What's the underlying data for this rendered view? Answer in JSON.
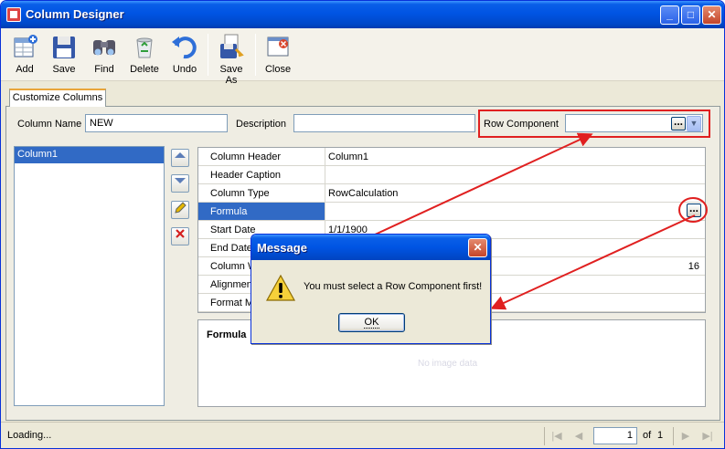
{
  "window": {
    "title": "Column Designer",
    "min_glyph": "_",
    "max_glyph": "□",
    "close_glyph": "✕"
  },
  "toolbar": {
    "add": "Add",
    "save": "Save",
    "find": "Find",
    "delete": "Delete",
    "undo": "Undo",
    "save_as": "Save As",
    "close": "Close"
  },
  "tabs": {
    "customize": "Customize Columns"
  },
  "form": {
    "column_name_label": "Column Name",
    "column_name_value": "NEW",
    "description_label": "Description",
    "description_value": "",
    "row_component_label": "Row Component",
    "row_component_value": ""
  },
  "list": {
    "items": [
      "Column1"
    ]
  },
  "grid": {
    "rows": [
      {
        "name": "Column Header",
        "value": "Column1"
      },
      {
        "name": "Header Caption",
        "value": ""
      },
      {
        "name": "Column Type",
        "value": "RowCalculation"
      },
      {
        "name": "Formula",
        "value": ""
      },
      {
        "name": "Start Date",
        "value": "1/1/1900"
      },
      {
        "name": "End Date",
        "value": ""
      },
      {
        "name": "Column W",
        "value": "16"
      },
      {
        "name": "Alignmen",
        "value": ""
      },
      {
        "name": "Format M",
        "value": ""
      }
    ]
  },
  "description_pane": {
    "title": "Formula",
    "watermark": "No image data"
  },
  "status": {
    "text": "Loading...",
    "page": "1",
    "of": "of",
    "total": "1"
  },
  "dialog": {
    "title": "Message",
    "message": "You must select a Row Component first!",
    "ok": "OK",
    "close_glyph": "✕"
  },
  "colors": {
    "titlebar": "#0054E3",
    "selection": "#316AC5",
    "annotation_red": "#E02020"
  }
}
